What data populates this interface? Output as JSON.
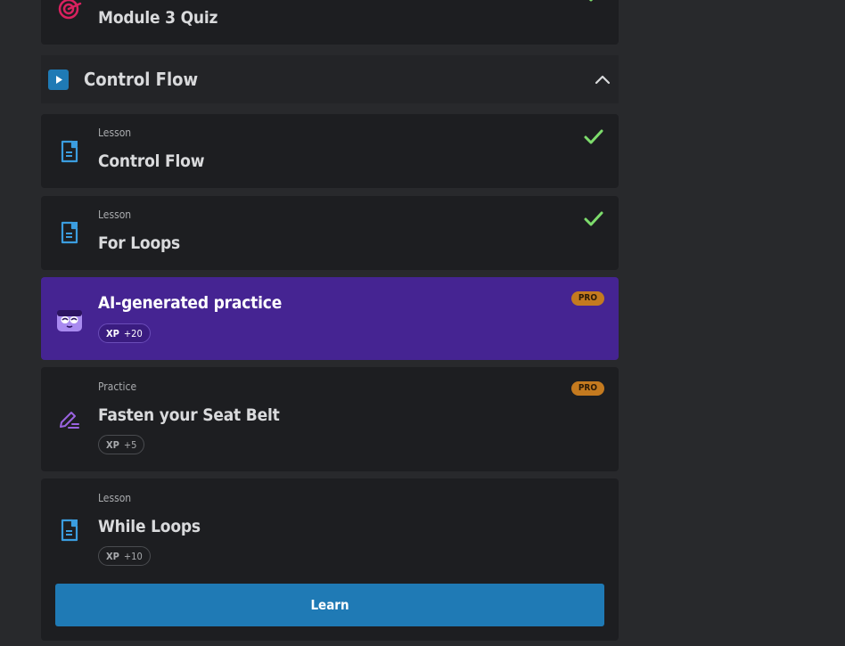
{
  "colors": {
    "background": "#28292c",
    "card": "#1d1e21",
    "accent_blue": "#1f7ab5",
    "ai_purple": "#452492",
    "check_green": "#7ddc6c",
    "pro_orange": "#c47a1f",
    "lesson_icon": "#3b9ddf",
    "quiz_icon": "#d9215f",
    "practice_icon": "#9a63e0"
  },
  "top_item": {
    "title": "Module 3 Quiz",
    "icon": "target-icon",
    "completed": true
  },
  "section": {
    "title": "Control Flow",
    "icon": "play-icon",
    "expanded": true
  },
  "items": [
    {
      "kind": "Lesson",
      "title": "Control Flow",
      "icon": "lesson-document-icon",
      "completed": true
    },
    {
      "kind": "Lesson",
      "title": "For Loops",
      "icon": "lesson-document-icon",
      "completed": true
    },
    {
      "kind": "",
      "title": "AI-generated practice",
      "icon": "ai-mascot-icon",
      "badge": "PRO",
      "xp_label": "XP",
      "xp_value": "+20"
    },
    {
      "kind": "Practice",
      "title": "Fasten your Seat Belt",
      "icon": "practice-pencil-icon",
      "badge": "PRO",
      "xp_label": "XP",
      "xp_value": "+5"
    },
    {
      "kind": "Lesson",
      "title": "While Loops",
      "icon": "lesson-document-icon",
      "xp_label": "XP",
      "xp_value": "+10",
      "button": "Learn"
    }
  ]
}
